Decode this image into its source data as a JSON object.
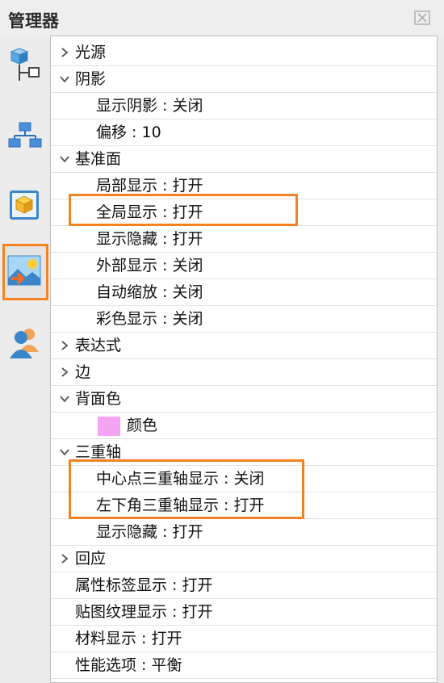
{
  "window": {
    "title": "管理器"
  },
  "rows": [
    {
      "label": "光源",
      "arrow": "right",
      "level": 0
    },
    {
      "label": "阴影",
      "arrow": "down",
      "level": 0
    },
    {
      "label": "显示阴影 : 关闭",
      "level": 1
    },
    {
      "label": "偏移 : 10",
      "level": 1
    },
    {
      "label": "基准面",
      "arrow": "down",
      "level": 0
    },
    {
      "label": "局部显示 : 打开",
      "level": 1
    },
    {
      "label": "全局显示 : 打开",
      "level": 1
    },
    {
      "label": "显示隐藏 : 打开",
      "level": 1
    },
    {
      "label": "外部显示 : 关闭",
      "level": 1
    },
    {
      "label": "自动缩放 : 关闭",
      "level": 1
    },
    {
      "label": "彩色显示 : 关闭",
      "level": 1
    },
    {
      "label": "表达式",
      "arrow": "right",
      "level": 0
    },
    {
      "label": "边",
      "arrow": "right",
      "level": 0
    },
    {
      "label": "背面色",
      "arrow": "down",
      "level": 0
    },
    {
      "label": "颜色",
      "level": 1,
      "swatch": "#f5a3f3"
    },
    {
      "label": "三重轴",
      "arrow": "down",
      "level": 0
    },
    {
      "label": "中心点三重轴显示 : 关闭",
      "level": 1
    },
    {
      "label": "左下角三重轴显示 : 打开",
      "level": 1
    },
    {
      "label": "显示隐藏 : 打开",
      "level": 1
    },
    {
      "label": "回应",
      "arrow": "right",
      "level": 0
    },
    {
      "label": "属性标签显示 : 打开",
      "level": 0
    },
    {
      "label": "贴图纹理显示 : 打开",
      "level": 0
    },
    {
      "label": "材料显示 : 打开",
      "level": 0
    },
    {
      "label": "性能选项 : 平衡",
      "level": 0
    }
  ],
  "sidebar": {
    "items": [
      {
        "icon": "model-tree-icon"
      },
      {
        "icon": "hierarchy-icon"
      },
      {
        "icon": "appearance-box-icon"
      },
      {
        "icon": "scene-image-icon",
        "active": true
      },
      {
        "icon": "users-icon"
      }
    ]
  },
  "colors": {
    "highlight": "#f58220",
    "swatch": "#f5a3f3"
  }
}
